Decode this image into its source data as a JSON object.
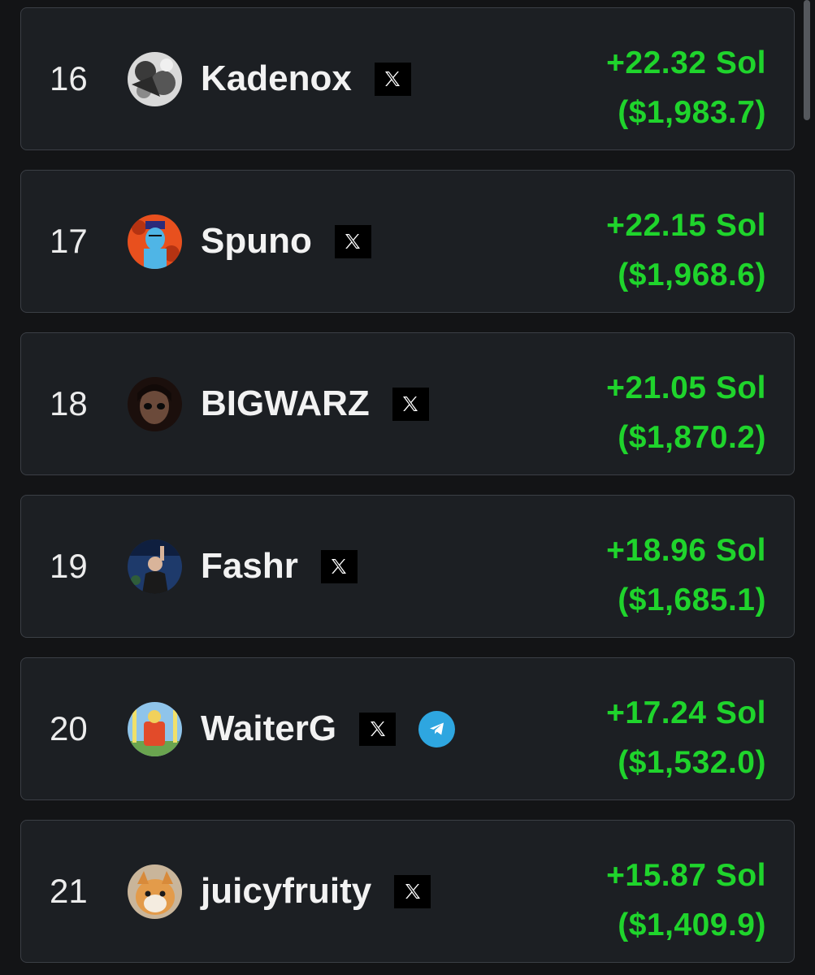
{
  "colors": {
    "background": "#131416",
    "card": "#1c1f23",
    "card_border": "#3b3f45",
    "profit_green": "#1fd42c",
    "telegram_blue": "#2ea6e0"
  },
  "leaderboard": [
    {
      "rank": "16",
      "name": "Kadenox",
      "avatar_icon": "avatar-kadenox",
      "socials": [
        "x-icon"
      ],
      "sol": "+22.32 Sol",
      "usd": "($1,983.7)"
    },
    {
      "rank": "17",
      "name": "Spuno",
      "avatar_icon": "avatar-spuno",
      "socials": [
        "x-icon"
      ],
      "sol": "+22.15 Sol",
      "usd": "($1,968.6)"
    },
    {
      "rank": "18",
      "name": "BIGWARZ",
      "avatar_icon": "avatar-bigwarz",
      "socials": [
        "x-icon"
      ],
      "sol": "+21.05 Sol",
      "usd": "($1,870.2)"
    },
    {
      "rank": "19",
      "name": "Fashr",
      "avatar_icon": "avatar-fashr",
      "socials": [
        "x-icon"
      ],
      "sol": "+18.96 Sol",
      "usd": "($1,685.1)"
    },
    {
      "rank": "20",
      "name": "WaiterG",
      "avatar_icon": "avatar-waiterg",
      "socials": [
        "x-icon",
        "telegram-icon"
      ],
      "sol": "+17.24 Sol",
      "usd": "($1,532.0)"
    },
    {
      "rank": "21",
      "name": "juicyfruity",
      "avatar_icon": "avatar-juicyfruity",
      "socials": [
        "x-icon"
      ],
      "sol": "+15.87 Sol",
      "usd": "($1,409.9)"
    }
  ]
}
